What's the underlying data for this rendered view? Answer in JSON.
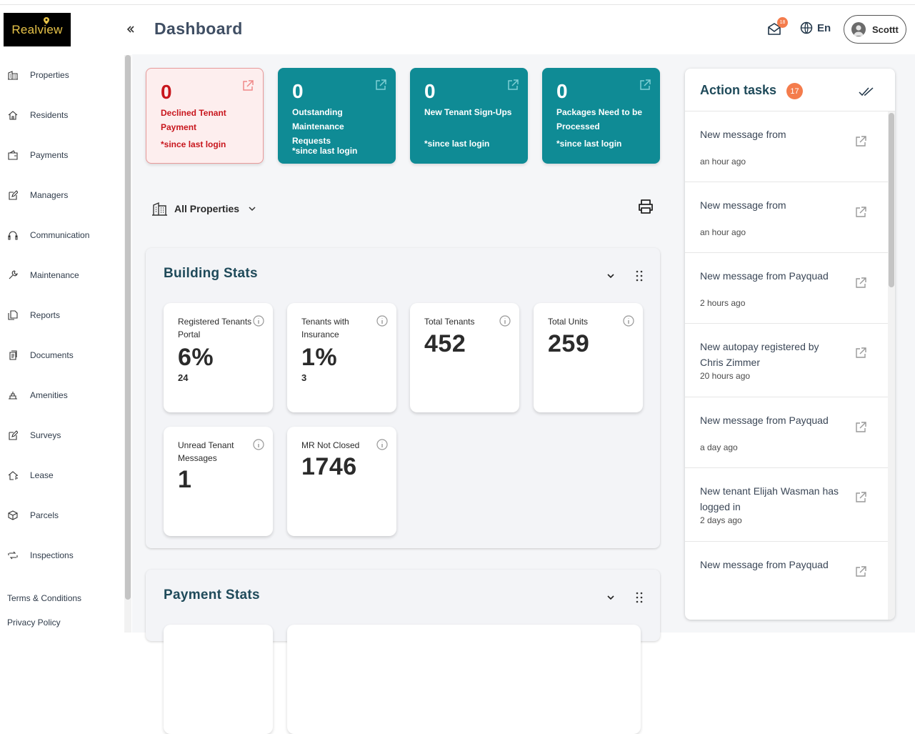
{
  "brand": {
    "logo_text": "Realview"
  },
  "sidebar": {
    "items": [
      {
        "label": "Properties",
        "icon": "building-icon"
      },
      {
        "label": "Residents",
        "icon": "home-icon"
      },
      {
        "label": "Payments",
        "icon": "wallet-icon"
      },
      {
        "label": "Managers",
        "icon": "edit-icon"
      },
      {
        "label": "Communication",
        "icon": "headset-icon"
      },
      {
        "label": "Maintenance",
        "icon": "wrench-icon"
      },
      {
        "label": "Reports",
        "icon": "copy-icon"
      },
      {
        "label": "Documents",
        "icon": "document-icon"
      },
      {
        "label": "Amenities",
        "icon": "amenities-icon"
      },
      {
        "label": "Surveys",
        "icon": "survey-icon"
      },
      {
        "label": "Lease",
        "icon": "lease-icon"
      },
      {
        "label": "Parcels",
        "icon": "box-icon"
      },
      {
        "label": "Inspections",
        "icon": "inspection-icon"
      }
    ],
    "terms_label": "Terms & Conditions",
    "privacy_label": "Privacy Policy"
  },
  "header": {
    "title": "Dashboard",
    "mail_badge": "18",
    "language": "En",
    "user_name": "Scottt"
  },
  "summary_cards": [
    {
      "count": "0",
      "label": "Declined Tenant Payment",
      "since": "*since last login",
      "style": "alert",
      "color": "#c8161d"
    },
    {
      "count": "0",
      "label": "Outstanding Maintenance Requests",
      "since": "*since last login",
      "style": "primary",
      "color": "#0f8b95"
    },
    {
      "count": "0",
      "label": "New Tenant Sign-Ups",
      "since": "*since last login",
      "style": "primary",
      "color": "#0f8b95"
    },
    {
      "count": "0",
      "label": "Packages Need to be Processed",
      "since": "*since last login",
      "style": "primary",
      "color": "#0f8b95"
    }
  ],
  "filter": {
    "property_label": "All Properties"
  },
  "building_stats": {
    "title": "Building Stats",
    "cards": [
      {
        "label": "Registered Tenants Portal",
        "value": "6%",
        "sub": "24"
      },
      {
        "label": "Tenants with Insurance",
        "value": "1%",
        "sub": "3"
      },
      {
        "label": "Total Tenants",
        "value": "452",
        "sub": ""
      },
      {
        "label": "Total Units",
        "value": "259",
        "sub": ""
      },
      {
        "label": "Unread Tenant Messages",
        "value": "1",
        "sub": ""
      },
      {
        "label": "MR Not Closed",
        "value": "1746",
        "sub": ""
      }
    ]
  },
  "payment_stats": {
    "title": "Payment Stats"
  },
  "action_tasks": {
    "title": "Action tasks",
    "badge": "17",
    "items": [
      {
        "text": "New message from",
        "time": "an hour ago"
      },
      {
        "text": "New message from",
        "time": "an hour ago"
      },
      {
        "text": "New message from Payquad",
        "time": "2 hours ago"
      },
      {
        "text": "New autopay registered by Chris Zimmer",
        "time": "20 hours ago"
      },
      {
        "text": "New message from Payquad",
        "time": "a day ago"
      },
      {
        "text": "New tenant Elijah Wasman has logged in",
        "time": "2 days ago"
      },
      {
        "text": "New message from Payquad",
        "time": ""
      }
    ]
  },
  "colors": {
    "accent": "#0f8b95",
    "badge": "#f47c4c",
    "title": "#3f4e63",
    "alert": "#c8161d"
  }
}
